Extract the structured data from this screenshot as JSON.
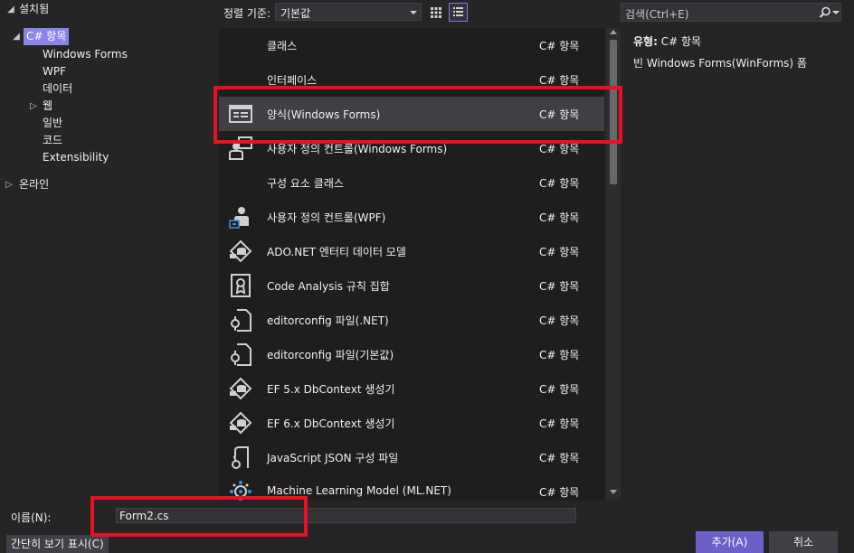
{
  "sidebar": {
    "installed": "설치됨",
    "csharp_items": "C# 항목",
    "children": [
      "Windows Forms",
      "WPF",
      "데이터",
      "웹",
      "일반",
      "코드",
      "Extensibility"
    ],
    "online": "온라인"
  },
  "toolbar": {
    "sort_label": "정렬 기준:",
    "sort_value": "기본값"
  },
  "search": {
    "placeholder": "검색(Ctrl+E)"
  },
  "templates": [
    {
      "name": "클래스",
      "lang": "C# 항목",
      "icon": "none"
    },
    {
      "name": "인터페이스",
      "lang": "C# 항목",
      "icon": "none"
    },
    {
      "name": "양식(Windows Forms)",
      "lang": "C# 항목",
      "icon": "form-icon",
      "selected": true
    },
    {
      "name": "사용자 정의 컨트롤(Windows Forms)",
      "lang": "C# 항목",
      "icon": "user-control-icon"
    },
    {
      "name": "구성 요소 클래스",
      "lang": "C# 항목",
      "icon": "none"
    },
    {
      "name": "사용자 정의 컨트롤(WPF)",
      "lang": "C# 항목",
      "icon": "wpf-user-control-icon"
    },
    {
      "name": "ADO.NET 엔터티 데이터 모델",
      "lang": "C# 항목",
      "icon": "data-model-icon"
    },
    {
      "name": "Code Analysis 규칙 집합",
      "lang": "C# 항목",
      "icon": "ruleset-icon"
    },
    {
      "name": "editorconfig 파일(.NET)",
      "lang": "C# 항목",
      "icon": "config-file-icon"
    },
    {
      "name": "editorconfig 파일(기본값)",
      "lang": "C# 항목",
      "icon": "config-file-icon"
    },
    {
      "name": "EF 5.x DbContext 생성기",
      "lang": "C# 항목",
      "icon": "data-model-icon"
    },
    {
      "name": "EF 6.x DbContext 생성기",
      "lang": "C# 항목",
      "icon": "data-model-icon"
    },
    {
      "name": "JavaScript JSON 구성 파일",
      "lang": "C# 항목",
      "icon": "json-config-icon"
    },
    {
      "name": "Machine Learning Model (ML.NET)",
      "lang": "C# 항목",
      "icon": "ml-model-icon"
    }
  ],
  "details": {
    "type_label": "유형:",
    "type_value": "C# 항목",
    "description": "빈 Windows Forms(WinForms) 폼"
  },
  "footer": {
    "name_label": "이름(N):",
    "name_value": "Form2.cs",
    "compact_view": "간단히 보기 표시(C)",
    "add": "추가(A)",
    "cancel": "취소"
  },
  "colors": {
    "accent": "#6c5fc7",
    "highlight_annotation": "#e81123"
  }
}
